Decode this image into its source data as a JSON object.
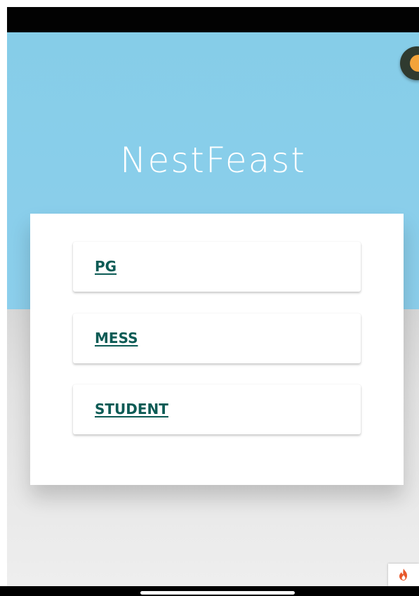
{
  "app": {
    "title": "NestFeast"
  },
  "roles": {
    "pg_label": "PG",
    "mess_label": "MESS",
    "student_label": "STUDENT"
  },
  "icons": {
    "avatar": "avatar-icon",
    "dev_badge": "flame-icon"
  },
  "colors": {
    "hero_background": "#86cde8",
    "lower_background": "#e0e0e0",
    "card_background": "#ffffff",
    "button_text": "#0c5b55",
    "title_text": "#ffffff",
    "avatar_accent": "#f2a33a",
    "badge_flame": "#e8582b"
  }
}
